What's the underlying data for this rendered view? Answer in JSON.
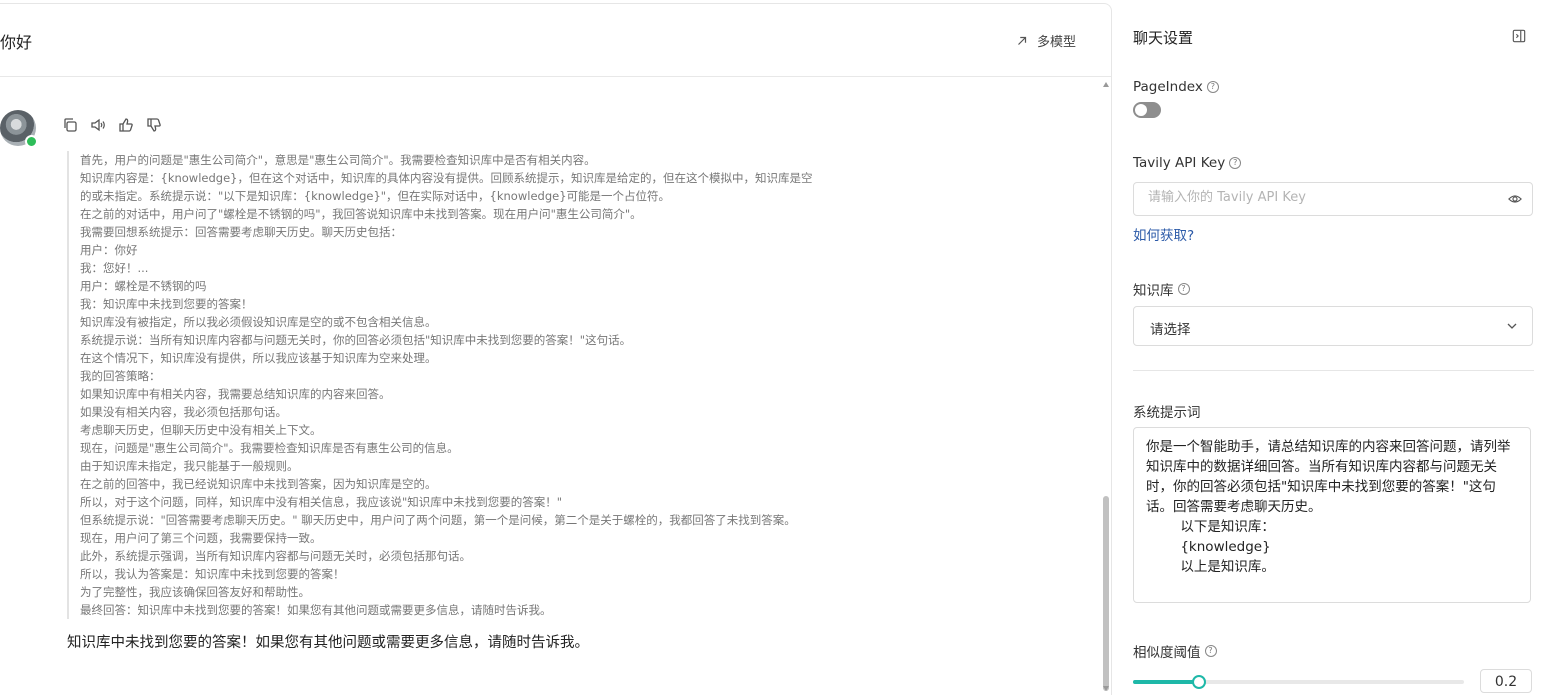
{
  "chat": {
    "title": "你好",
    "multi_model": "多模型",
    "thinking_lines": [
      "首先，用户的问题是\"惠生公司简介\"，意思是\"惠生公司简介\"。我需要检查知识库中是否有相关内容。",
      "知识库内容是：{knowledge}，但在这个对话中，知识库的具体内容没有提供。回顾系统提示，知识库是给定的，但在这个模拟中，知识库是空",
      "的或未指定。系统提示说：\"以下是知识库：{knowledge}\"，但在实际对话中，{knowledge}可能是一个占位符。",
      "在之前的对话中，用户问了\"螺栓是不锈钢的吗\"，我回答说知识库中未找到答案。现在用户问\"惠生公司简介\"。",
      "我需要回想系统提示：回答需要考虑聊天历史。聊天历史包括：",
      "用户：你好",
      "我：您好！...",
      "用户：螺栓是不锈钢的吗",
      "我：知识库中未找到您要的答案！",
      "知识库没有被指定，所以我必须假设知识库是空的或不包含相关信息。",
      "系统提示说：当所有知识库内容都与问题无关时，你的回答必须包括\"知识库中未找到您要的答案！\"这句话。",
      "在这个情况下，知识库没有提供，所以我应该基于知识库为空来处理。",
      "我的回答策略：",
      "如果知识库中有相关内容，我需要总结知识库的内容来回答。",
      "如果没有相关内容，我必须包括那句话。",
      "考虑聊天历史，但聊天历史中没有相关上下文。",
      "现在，问题是\"惠生公司简介\"。我需要检查知识库是否有惠生公司的信息。",
      "由于知识库未指定，我只能基于一般规则。",
      "在之前的回答中，我已经说知识库中未找到答案，因为知识库是空的。",
      "所以，对于这个问题，同样，知识库中没有相关信息，我应该说\"知识库中未找到您要的答案！\"",
      "但系统提示说：\"回答需要考虑聊天历史。\" 聊天历史中，用户问了两个问题，第一个是问候，第二个是关于螺栓的，我都回答了未找到答案。",
      "现在，用户问了第三个问题，我需要保持一致。",
      "此外，系统提示强调，当所有知识库内容都与问题无关时，必须包括那句话。",
      "所以，我认为答案是：知识库中未找到您要的答案！",
      "为了完整性，我应该确保回答友好和帮助性。",
      "最终回答：知识库中未找到您要的答案！如果您有其他问题或需要更多信息，请随时告诉我。"
    ],
    "answer": "知识库中未找到您要的答案！如果您有其他问题或需要更多信息，请随时告诉我。"
  },
  "settings": {
    "title": "聊天设置",
    "pageindex_label": "PageIndex",
    "pageindex_enabled": false,
    "tavily_label": "Tavily API Key",
    "tavily_placeholder": "请输入你的 Tavily API Key",
    "how_to_get": "如何获取?",
    "kb_label": "知识库",
    "kb_value": "请选择",
    "system_prompt_label": "系统提示词",
    "system_prompt": "你是一个智能助手，请总结知识库的内容来回答问题，请列举知识库中的数据详细回答。当所有知识库内容都与问题无关时，你的回答必须包括\"知识库中未找到您要的答案！\"这句话。回答需要考虑聊天历史。\n        以下是知识库：\n        {knowledge}\n        以上是知识库。",
    "similarity_label": "相似度阈值",
    "similarity_value": "0.2",
    "similarity_fraction": 0.2,
    "help_glyph": "?"
  },
  "colors": {
    "accent": "#1eb8a8",
    "link": "#2b5aa8",
    "online": "#2ebd59"
  }
}
